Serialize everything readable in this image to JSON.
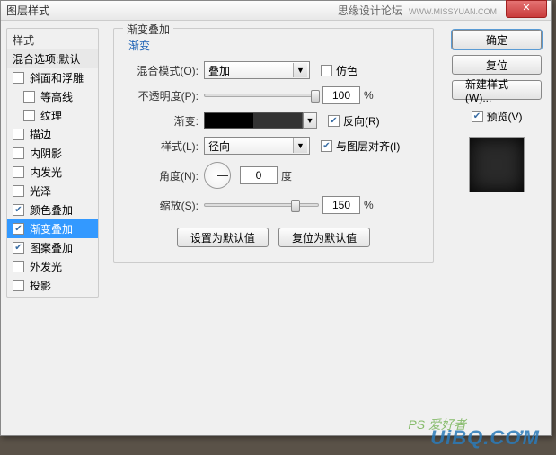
{
  "titlebar": {
    "title": "图层样式",
    "forum": "思缘设计论坛",
    "forum_url": "WWW.MISSYUAN.COM",
    "close": "✕"
  },
  "left": {
    "legend": "样式",
    "header": "混合选项:默认",
    "items": [
      {
        "label": "斜面和浮雕",
        "checked": false,
        "indent": false
      },
      {
        "label": "等高线",
        "checked": false,
        "indent": true
      },
      {
        "label": "纹理",
        "checked": false,
        "indent": true
      },
      {
        "label": "描边",
        "checked": false,
        "indent": false
      },
      {
        "label": "内阴影",
        "checked": false,
        "indent": false
      },
      {
        "label": "内发光",
        "checked": false,
        "indent": false
      },
      {
        "label": "光泽",
        "checked": false,
        "indent": false
      },
      {
        "label": "颜色叠加",
        "checked": true,
        "indent": false
      },
      {
        "label": "渐变叠加",
        "checked": true,
        "indent": false,
        "selected": true
      },
      {
        "label": "图案叠加",
        "checked": true,
        "indent": false
      },
      {
        "label": "外发光",
        "checked": false,
        "indent": false
      },
      {
        "label": "投影",
        "checked": false,
        "indent": false
      }
    ]
  },
  "center": {
    "group_title": "渐变叠加",
    "sub_title": "渐变",
    "blend_mode_label": "混合模式(O):",
    "blend_mode_value": "叠加",
    "dither_label": "仿色",
    "dither_checked": false,
    "opacity_label": "不透明度(P):",
    "opacity_value": "100",
    "percent": "%",
    "gradient_label": "渐变:",
    "reverse_label": "反向(R)",
    "reverse_checked": true,
    "style_label": "样式(L):",
    "style_value": "径向",
    "align_label": "与图层对齐(I)",
    "align_checked": true,
    "angle_label": "角度(N):",
    "angle_value": "0",
    "degree": "度",
    "scale_label": "缩放(S):",
    "scale_value": "150",
    "btn_default": "设置为默认值",
    "btn_reset": "复位为默认值"
  },
  "right": {
    "ok": "确定",
    "cancel": "复位",
    "new_style": "新建样式(W)...",
    "preview_label": "预览(V)",
    "preview_checked": true
  },
  "watermark": {
    "main": "UiBQ.CƠM",
    "sub": "PS 爱好者"
  }
}
